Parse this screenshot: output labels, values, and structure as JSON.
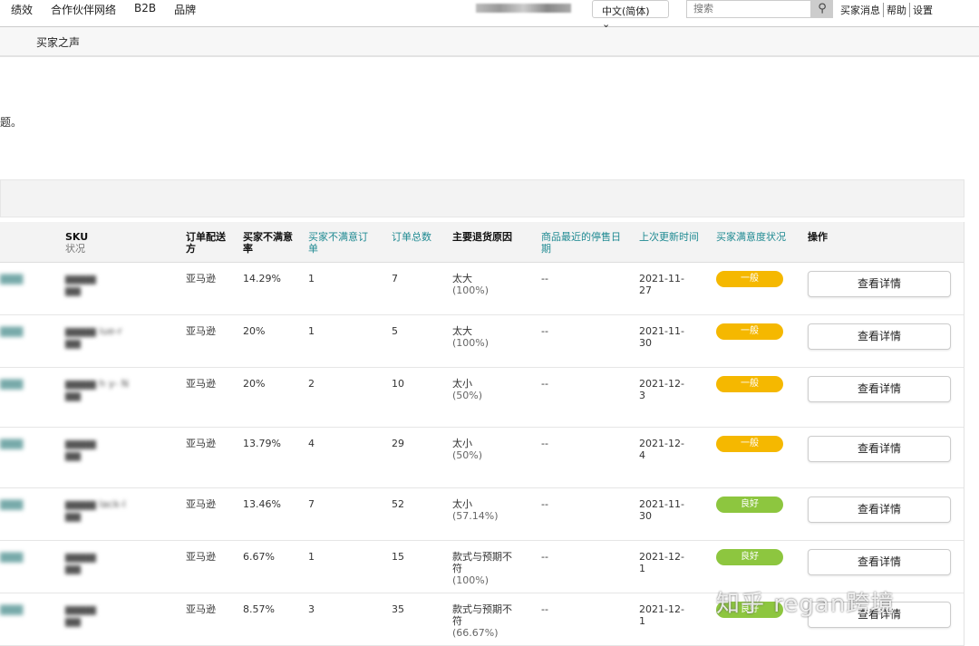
{
  "topnav": {
    "items": [
      "绩效",
      "合作伙伴网络",
      "B2B",
      "品牌"
    ],
    "language": "中文(简体)",
    "search_placeholder": "搜索",
    "links": [
      "买家消息",
      "帮助",
      "设置"
    ]
  },
  "subnav": {
    "label": "买家之声"
  },
  "note": "题。",
  "table": {
    "headers": {
      "col0": "",
      "sku": "SKU",
      "sku_sub": "状况",
      "fulfillment": "订单配送方",
      "ncx_rate": "买家不满意率",
      "ncx_orders": "买家不满意订单",
      "total_orders": "订单总数",
      "return_reason": "主要退货原因",
      "last_stop": "商品最近的停售日期",
      "updated": "上次更新时间",
      "status": "买家满意度状况",
      "action": "操作"
    },
    "rows": [
      {
        "sku": "",
        "fulfillment": "亚马逊",
        "ncx_rate": "14.29%",
        "ncx_orders": "1",
        "total_orders": "7",
        "reason": "太大",
        "reason_pct": "(100%)",
        "last_stop": "--",
        "updated": "2021-11-27",
        "status": "一般",
        "action": "查看详情"
      },
      {
        "sku": "iue-r",
        "fulfillment": "亚马逊",
        "ncx_rate": "20%",
        "ncx_orders": "1",
        "total_orders": "5",
        "reason": "太大",
        "reason_pct": "(100%)",
        "last_stop": "--",
        "updated": "2021-11-30",
        "status": "一般",
        "action": "查看详情"
      },
      {
        "sku": "h y- N",
        "fulfillment": "亚马逊",
        "ncx_rate": "20%",
        "ncx_orders": "2",
        "total_orders": "10",
        "reason": "太小",
        "reason_pct": "(50%)",
        "last_stop": "--",
        "updated": "2021-12-3",
        "status": "一般",
        "action": "查看详情"
      },
      {
        "sku": "",
        "fulfillment": "亚马逊",
        "ncx_rate": "13.79%",
        "ncx_orders": "4",
        "total_orders": "29",
        "reason": "太小",
        "reason_pct": "(50%)",
        "last_stop": "--",
        "updated": "2021-12-4",
        "status": "一般",
        "action": "查看详情"
      },
      {
        "sku": "lack-l",
        "fulfillment": "亚马逊",
        "ncx_rate": "13.46%",
        "ncx_orders": "7",
        "total_orders": "52",
        "reason": "太小",
        "reason_pct": "(57.14%)",
        "last_stop": "--",
        "updated": "2021-11-30",
        "status": "良好",
        "action": "查看详情"
      },
      {
        "sku": "",
        "fulfillment": "亚马逊",
        "ncx_rate": "6.67%",
        "ncx_orders": "1",
        "total_orders": "15",
        "reason": "款式与预期不符",
        "reason_pct": "(100%)",
        "last_stop": "--",
        "updated": "2021-12-1",
        "status": "良好",
        "action": "查看详情"
      },
      {
        "sku": "",
        "fulfillment": "亚马逊",
        "ncx_rate": "8.57%",
        "ncx_orders": "3",
        "total_orders": "35",
        "reason": "款式与预期不符",
        "reason_pct": "(66.67%)",
        "last_stop": "--",
        "updated": "2021-12-1",
        "status": "良好",
        "action": "查看详情"
      }
    ]
  },
  "status_colors": {
    "一般": "#f5b800",
    "良好": "#8dc63f"
  },
  "watermark": "知乎 regan跨境"
}
